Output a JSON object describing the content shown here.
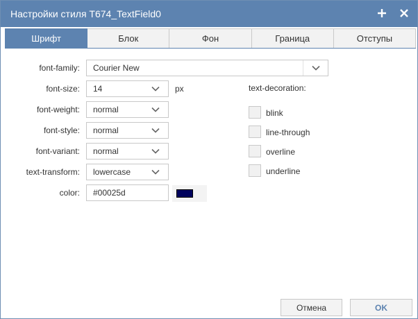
{
  "window": {
    "title": "Настройки стиля T674_TextField0",
    "icons": {
      "add": "plus-icon",
      "close": "close-icon"
    }
  },
  "tabs": [
    {
      "label": "Шрифт",
      "active": true
    },
    {
      "label": "Блок",
      "active": false
    },
    {
      "label": "Фон",
      "active": false
    },
    {
      "label": "Граница",
      "active": false
    },
    {
      "label": "Отступы",
      "active": false
    }
  ],
  "font": {
    "family": {
      "label": "font-family:",
      "value": "Courier New"
    },
    "size": {
      "label": "font-size:",
      "value": "14",
      "unit": "px"
    },
    "weight": {
      "label": "font-weight:",
      "value": "normal"
    },
    "style": {
      "label": "font-style:",
      "value": "normal"
    },
    "variant": {
      "label": "font-variant:",
      "value": "normal"
    },
    "transform": {
      "label": "text-transform:",
      "value": "lowercase"
    },
    "color": {
      "label": "color:",
      "value": "#00025d",
      "swatch": "#00025d"
    }
  },
  "decoration": {
    "title": "text-decoration:",
    "options": [
      {
        "label": "blink",
        "checked": false
      },
      {
        "label": "line-through",
        "checked": false
      },
      {
        "label": "overline",
        "checked": false
      },
      {
        "label": "underline",
        "checked": false
      }
    ]
  },
  "buttons": {
    "cancel": "Отмена",
    "ok": "OK"
  },
  "colors": {
    "accent": "#5d83b0",
    "border": "#c8c8c8"
  }
}
